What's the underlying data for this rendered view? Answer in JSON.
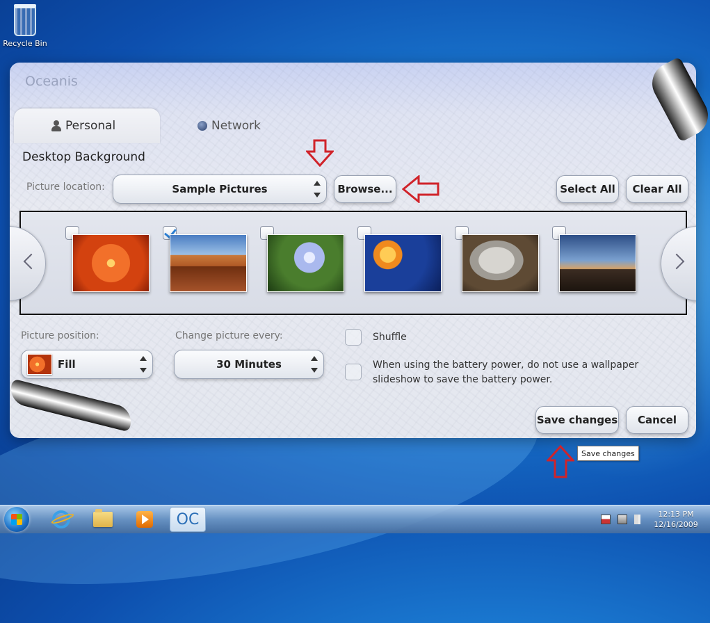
{
  "desktop": {
    "icon_label": "Recycle Bin"
  },
  "window": {
    "title": "Oceanis",
    "tabs": [
      {
        "label": "Personal",
        "icon": "person-icon",
        "active": true
      },
      {
        "label": "Network",
        "icon": "globe-icon",
        "active": false
      }
    ],
    "section_title": "Desktop Background",
    "picture_location": {
      "label": "Picture location:",
      "value": "Sample Pictures"
    },
    "browse_label": "Browse...",
    "select_all_label": "Select All",
    "clear_all_label": "Clear All",
    "thumbnails": [
      {
        "name": "chrysanthemum",
        "checked": false
      },
      {
        "name": "desert",
        "checked": true
      },
      {
        "name": "hydrangeas",
        "checked": false
      },
      {
        "name": "jellyfish",
        "checked": false
      },
      {
        "name": "koala",
        "checked": false
      },
      {
        "name": "lighthouse",
        "checked": false
      }
    ],
    "picture_position": {
      "label": "Picture position:",
      "value": "Fill"
    },
    "change_picture": {
      "label": "Change picture every:",
      "value": "30 Minutes"
    },
    "shuffle_label": "Shuffle",
    "battery_text_line1": "When using the battery power, do not use a wallpaper",
    "battery_text_line2": "slideshow to save the battery power.",
    "save_label": "Save changes",
    "cancel_label": "Cancel"
  },
  "tooltip": "Save changes",
  "taskbar": {
    "apps": [
      "internet-explorer",
      "windows-explorer",
      "media-player",
      "oceanis"
    ],
    "oceanis_glyph": "OC",
    "time": "12:13 PM",
    "date": "12/16/2009"
  },
  "colors": {
    "annotation_arrow": "#d0232a",
    "check_accent": "#2c7fd3"
  }
}
